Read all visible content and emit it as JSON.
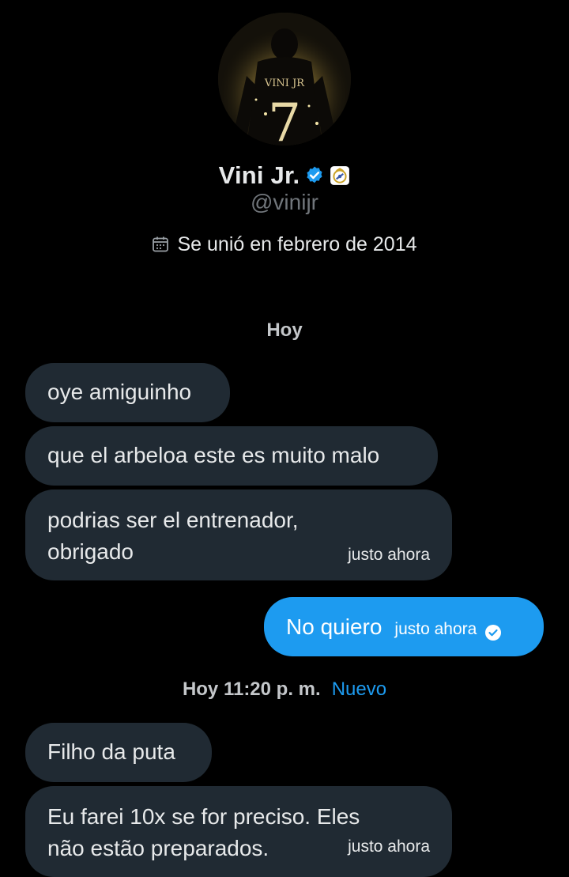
{
  "profile": {
    "name": "Vini Jr.",
    "handle": "@vinijr",
    "joined": "Se unió en febrero de 2014",
    "avatar_jersey_text": "VINI JR",
    "avatar_jersey_number": "7",
    "verified_color": "#1d9bf0"
  },
  "conversation": {
    "separator_1": "Hoy",
    "separator_2_time": "Hoy 11:20 p. m.",
    "separator_2_new": "Nuevo",
    "messages_1": [
      {
        "direction": "in",
        "text": "oye amiguinho"
      },
      {
        "direction": "in",
        "text": "que el arbeloa este es muito malo"
      },
      {
        "direction": "in",
        "text": "podrias ser el entrenador,\nobrigado",
        "time": "justo ahora"
      },
      {
        "direction": "out",
        "text": "No quiero",
        "time": "justo ahora",
        "status_icon": "seen-check-icon"
      }
    ],
    "messages_2": [
      {
        "direction": "in",
        "text": "Filho da puta"
      },
      {
        "direction": "in",
        "text": "Eu farei 10x se for preciso. Eles\nnão estão preparados.",
        "time": "justo ahora"
      }
    ]
  },
  "colors": {
    "background": "#000000",
    "incoming_bubble": "#202a33",
    "outgoing_bubble": "#1d9bf0",
    "accent": "#1d9bf0",
    "secondary_text": "#71767b"
  }
}
